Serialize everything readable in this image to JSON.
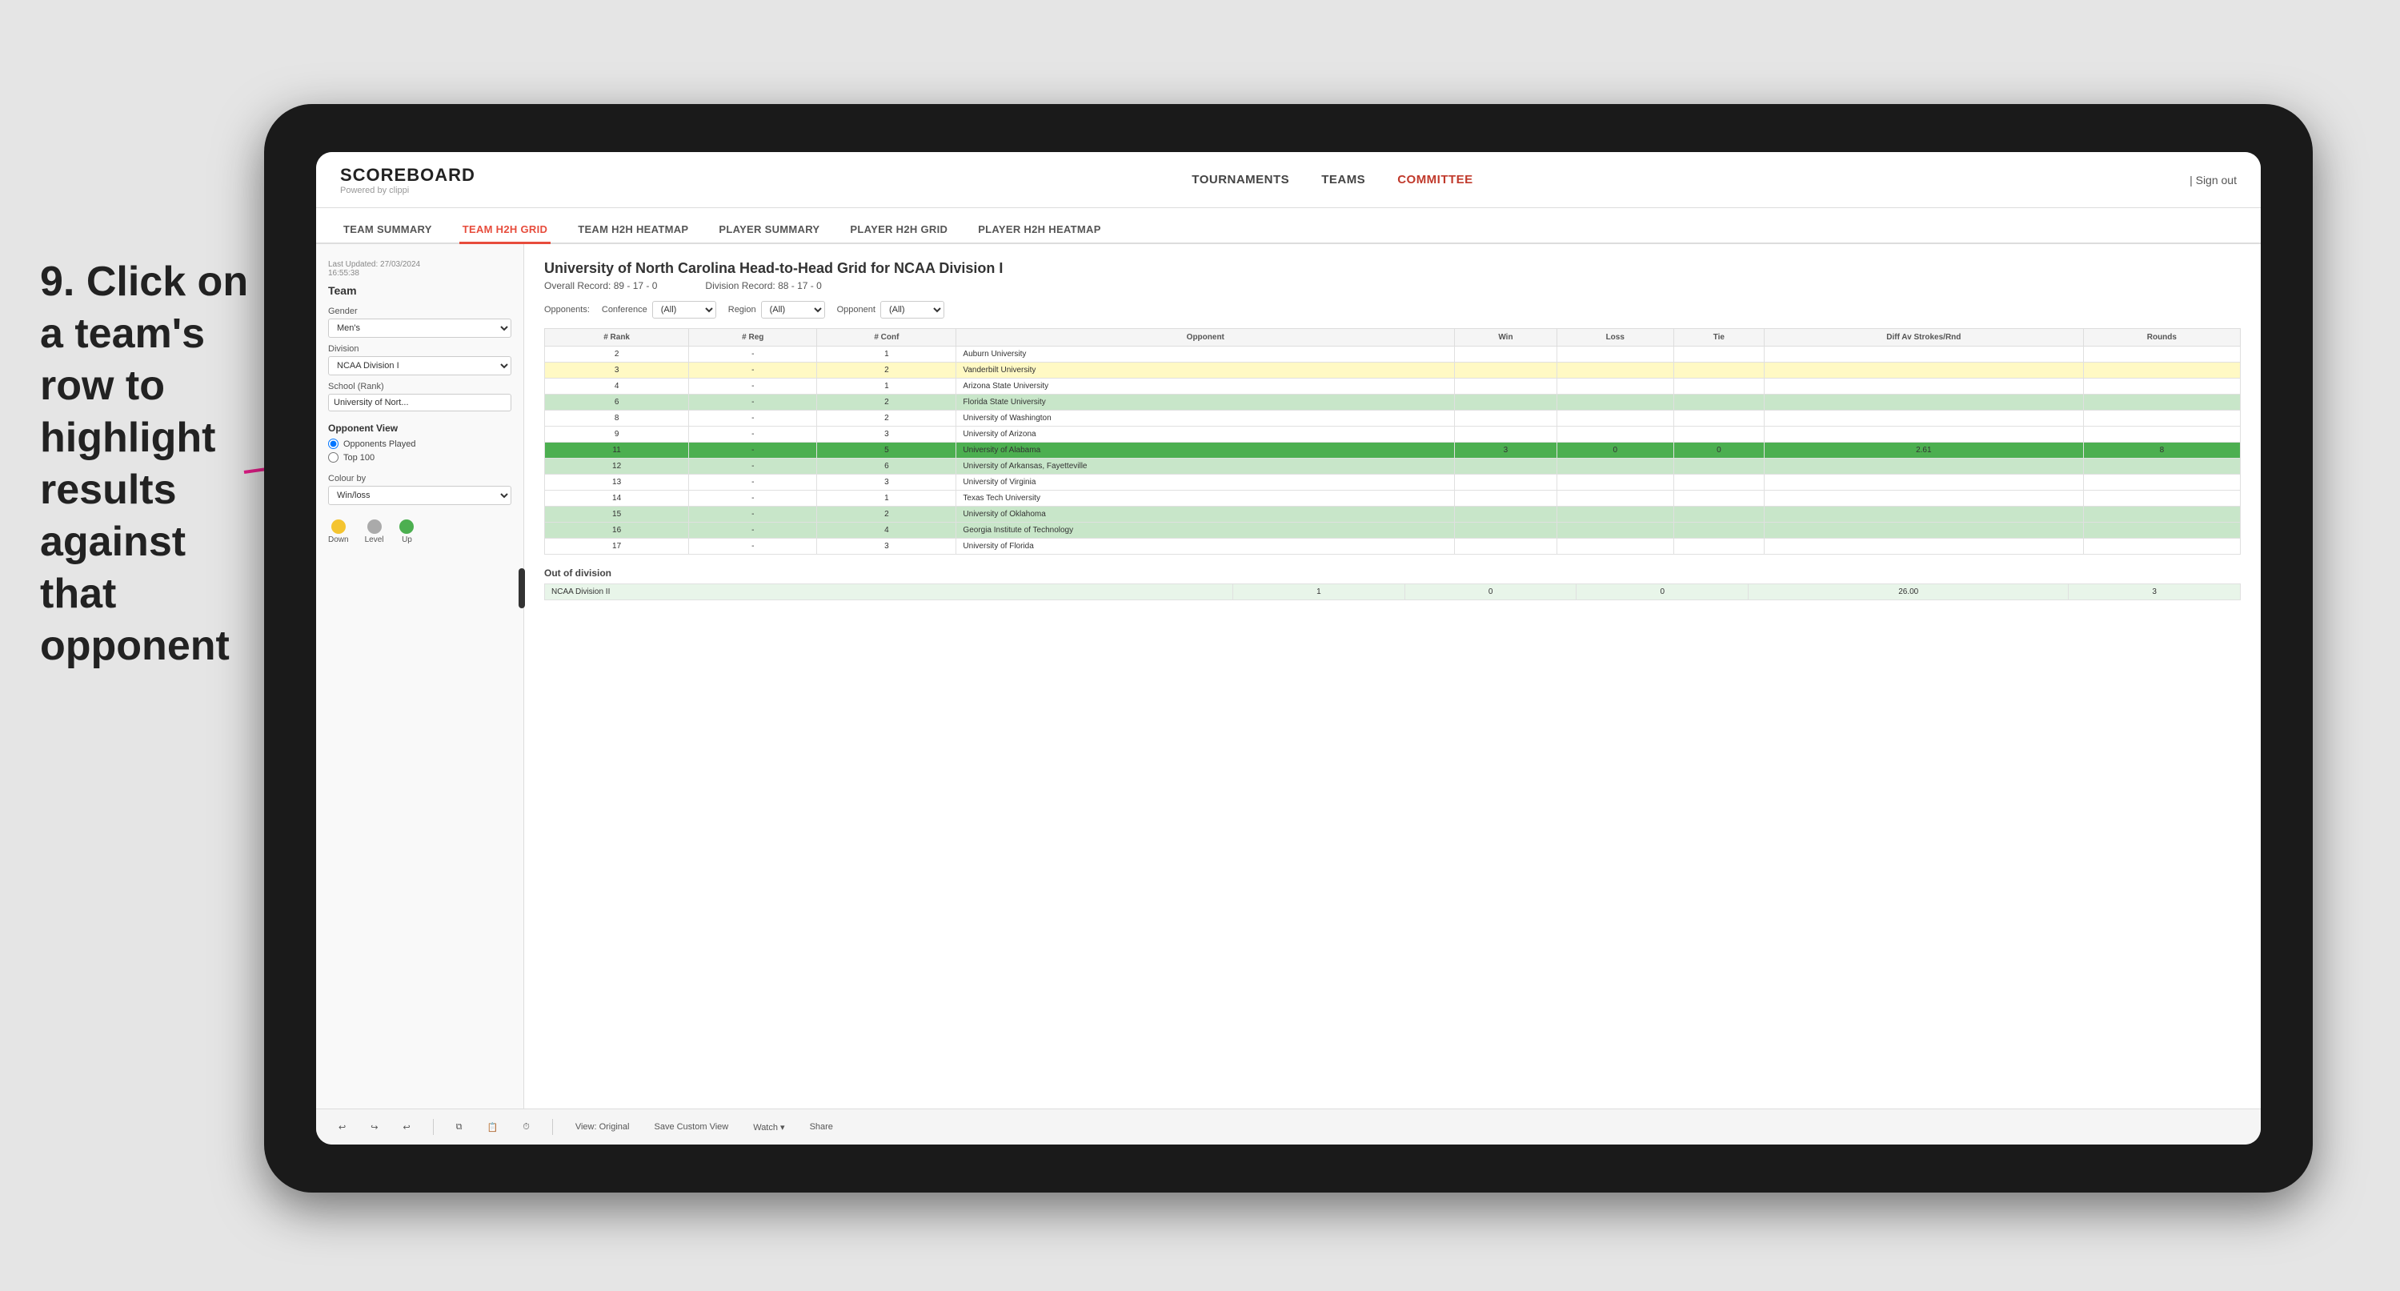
{
  "instruction": {
    "step": "9.",
    "text": "Click on a team's row to highlight results against that opponent"
  },
  "brand": {
    "title": "SCOREBOARD",
    "subtitle": "Powered by clippi"
  },
  "nav": {
    "links": [
      "TOURNAMENTS",
      "TEAMS",
      "COMMITTEE"
    ],
    "active": "COMMITTEE",
    "sign_out": "Sign out"
  },
  "sub_tabs": {
    "tabs": [
      "TEAM SUMMARY",
      "TEAM H2H GRID",
      "TEAM H2H HEATMAP",
      "PLAYER SUMMARY",
      "PLAYER H2H GRID",
      "PLAYER H2H HEATMAP"
    ],
    "active": "TEAM H2H GRID"
  },
  "sidebar": {
    "last_updated": "Last Updated: 27/03/2024",
    "last_time": "16:55:38",
    "team_label": "Team",
    "gender_label": "Gender",
    "gender_value": "Men's",
    "division_label": "Division",
    "division_value": "NCAA Division I",
    "school_label": "School (Rank)",
    "school_value": "University of Nort...",
    "opponent_view_label": "Opponent View",
    "radio_options": [
      "Opponents Played",
      "Top 100"
    ],
    "colour_label": "Colour by",
    "colour_value": "Win/loss",
    "colours": [
      {
        "label": "Down",
        "color": "#f4c430"
      },
      {
        "label": "Level",
        "color": "#aaa"
      },
      {
        "label": "Up",
        "color": "#4caf50"
      }
    ]
  },
  "grid": {
    "title": "University of North Carolina Head-to-Head Grid for NCAA Division I",
    "overall_record": "Overall Record: 89 - 17 - 0",
    "division_record": "Division Record: 88 - 17 - 0",
    "filters": {
      "opponents_label": "Opponents:",
      "conference_label": "Conference",
      "conference_value": "(All)",
      "region_label": "Region",
      "region_value": "(All)",
      "opponent_label": "Opponent",
      "opponent_value": "(All)"
    },
    "columns": [
      "# Rank",
      "# Reg",
      "# Conf",
      "Opponent",
      "Win",
      "Loss",
      "Tie",
      "Diff Av Strokes/Rnd",
      "Rounds"
    ],
    "rows": [
      {
        "rank": "2",
        "reg": "-",
        "conf": "1",
        "opponent": "Auburn University",
        "win": "",
        "loss": "",
        "tie": "",
        "diff": "",
        "rounds": "",
        "highlight": "none"
      },
      {
        "rank": "3",
        "reg": "-",
        "conf": "2",
        "opponent": "Vanderbilt University",
        "win": "",
        "loss": "",
        "tie": "",
        "diff": "",
        "rounds": "",
        "highlight": "light-yellow"
      },
      {
        "rank": "4",
        "reg": "-",
        "conf": "1",
        "opponent": "Arizona State University",
        "win": "",
        "loss": "",
        "tie": "",
        "diff": "",
        "rounds": "",
        "highlight": "none"
      },
      {
        "rank": "6",
        "reg": "-",
        "conf": "2",
        "opponent": "Florida State University",
        "win": "",
        "loss": "",
        "tie": "",
        "diff": "",
        "rounds": "",
        "highlight": "light-green"
      },
      {
        "rank": "8",
        "reg": "-",
        "conf": "2",
        "opponent": "University of Washington",
        "win": "",
        "loss": "",
        "tie": "",
        "diff": "",
        "rounds": "",
        "highlight": "none"
      },
      {
        "rank": "9",
        "reg": "-",
        "conf": "3",
        "opponent": "University of Arizona",
        "win": "",
        "loss": "",
        "tie": "",
        "diff": "",
        "rounds": "",
        "highlight": "none"
      },
      {
        "rank": "11",
        "reg": "-",
        "conf": "5",
        "opponent": "University of Alabama",
        "win": "3",
        "loss": "0",
        "tie": "0",
        "diff": "2.61",
        "rounds": "8",
        "highlight": "green"
      },
      {
        "rank": "12",
        "reg": "-",
        "conf": "6",
        "opponent": "University of Arkansas, Fayetteville",
        "win": "",
        "loss": "",
        "tie": "",
        "diff": "",
        "rounds": "",
        "highlight": "light-green"
      },
      {
        "rank": "13",
        "reg": "-",
        "conf": "3",
        "opponent": "University of Virginia",
        "win": "",
        "loss": "",
        "tie": "",
        "diff": "",
        "rounds": "",
        "highlight": "none"
      },
      {
        "rank": "14",
        "reg": "-",
        "conf": "1",
        "opponent": "Texas Tech University",
        "win": "",
        "loss": "",
        "tie": "",
        "diff": "",
        "rounds": "",
        "highlight": "none"
      },
      {
        "rank": "15",
        "reg": "-",
        "conf": "2",
        "opponent": "University of Oklahoma",
        "win": "",
        "loss": "",
        "tie": "",
        "diff": "",
        "rounds": "",
        "highlight": "light-green"
      },
      {
        "rank": "16",
        "reg": "-",
        "conf": "4",
        "opponent": "Georgia Institute of Technology",
        "win": "",
        "loss": "",
        "tie": "",
        "diff": "",
        "rounds": "",
        "highlight": "light-green"
      },
      {
        "rank": "17",
        "reg": "-",
        "conf": "3",
        "opponent": "University of Florida",
        "win": "",
        "loss": "",
        "tie": "",
        "diff": "",
        "rounds": "",
        "highlight": "none"
      }
    ],
    "out_of_division_label": "Out of division",
    "out_of_division_row": {
      "label": "NCAA Division II",
      "win": "1",
      "loss": "0",
      "tie": "0",
      "diff": "26.00",
      "rounds": "3"
    }
  },
  "toolbar": {
    "buttons": [
      "View: Original",
      "Save Custom View",
      "Watch ▾",
      "Share"
    ]
  }
}
